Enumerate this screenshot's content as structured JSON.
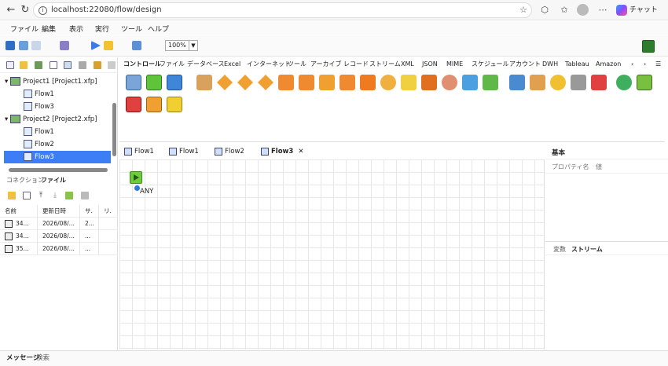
{
  "browser": {
    "url": "localhost:22080/flow/design",
    "copilot_label": "チャット"
  },
  "menu": [
    "ファイル",
    "編集",
    "表示",
    "実行",
    "ツール",
    "ヘルプ"
  ],
  "toolbar": {
    "zoom": "100%"
  },
  "tree": {
    "projects": [
      {
        "label": "Project1 [Project1.xfp]",
        "flows": [
          "Flow1",
          "Flow3"
        ]
      },
      {
        "label": "Project2 [Project2.xfp]",
        "flows": [
          "Flow1",
          "Flow2",
          "Flow3"
        ]
      }
    ],
    "selected": "Project2/Flow3"
  },
  "bottom_tabs": [
    "コネクション",
    "ファイル"
  ],
  "file_table": {
    "columns": [
      "名前",
      "更新日時",
      "サ.",
      "リ."
    ],
    "rows": [
      {
        "name": "34...",
        "date": "2026/08/...",
        "size": "2..."
      },
      {
        "name": "34...",
        "date": "2026/08/...",
        "size": "..."
      },
      {
        "name": "35...",
        "date": "2026/08/...",
        "size": "..."
      }
    ]
  },
  "palette_tabs": [
    "コントロール",
    "ファイル",
    "データベース",
    "Excel",
    "インターネット",
    "ツール",
    "アーカイブ",
    "レコード",
    "ストリーム",
    "XML",
    "JSON",
    "MIME",
    "スケジュール",
    "アカウント",
    "DWH",
    "Tableau",
    "Amazon"
  ],
  "editor_tabs": [
    "Flow1",
    "Flow1",
    "Flow2",
    "Flow3"
  ],
  "active_editor_tab": "Flow3",
  "canvas": {
    "node_label": "ANY"
  },
  "properties": {
    "title": "基本",
    "col_name": "プロパティ名",
    "col_value": "値",
    "bottom_tabs": [
      "変数",
      "ストリーム"
    ]
  },
  "status_tabs": [
    "メッセージ",
    "検索"
  ],
  "colors": {
    "accent": "#3d7df5",
    "start_node": "#6fcb3c"
  }
}
